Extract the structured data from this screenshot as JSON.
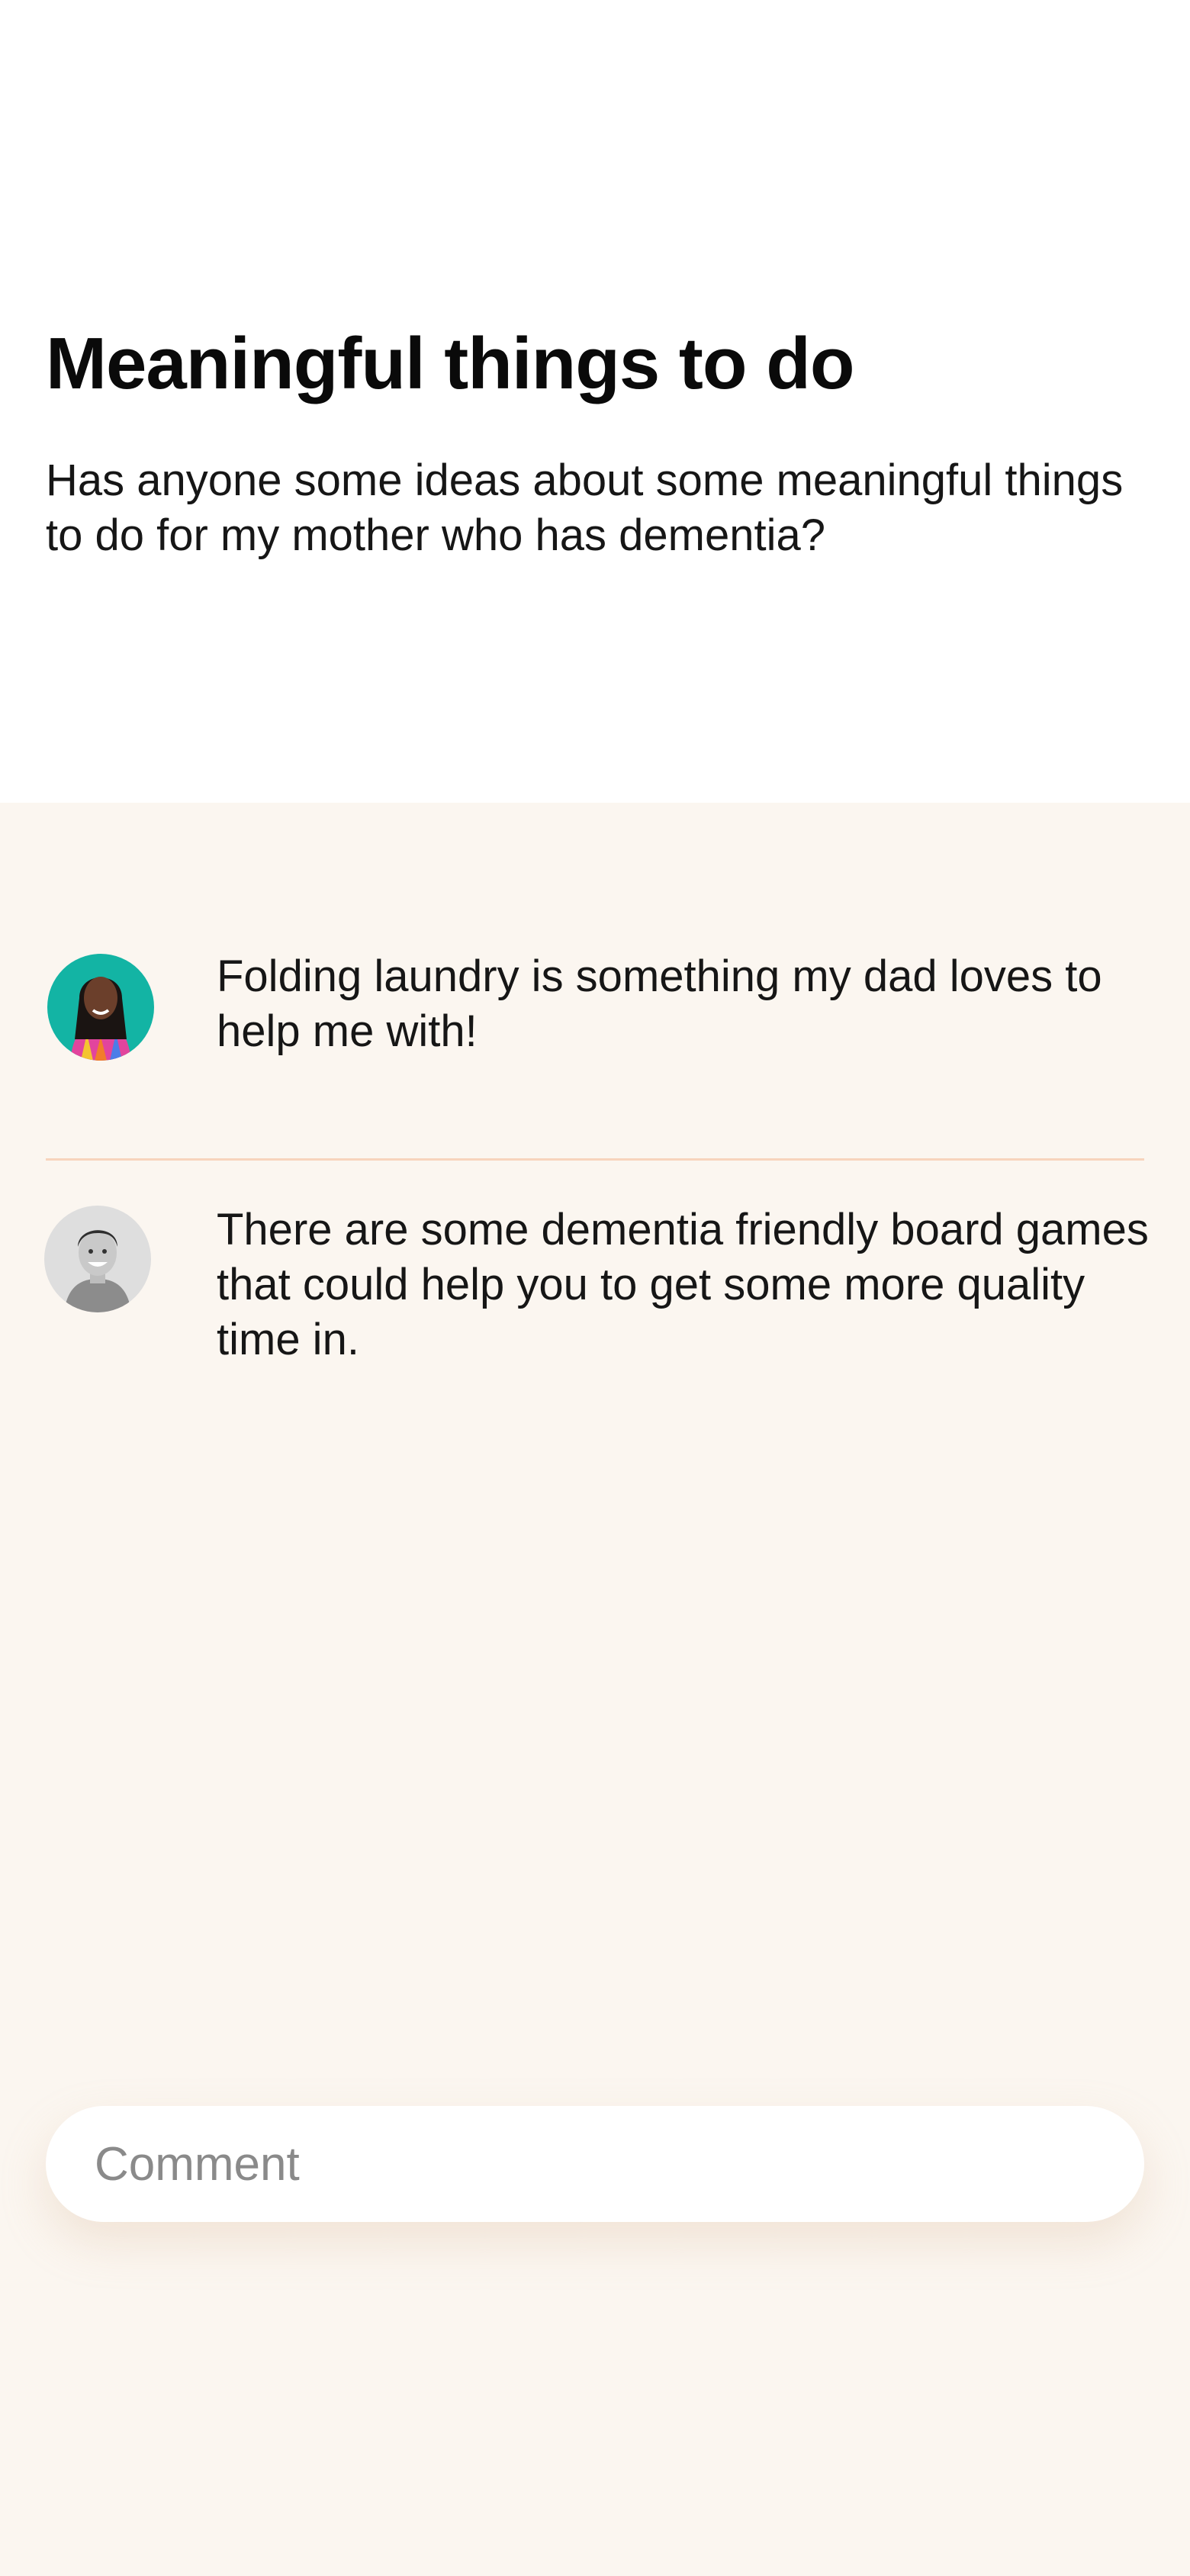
{
  "post": {
    "title": "Meaningful things to do",
    "body": "Has anyone some ideas about some meaningful things to do for my mother who has dementia?"
  },
  "comments": [
    {
      "text": "Folding laundry is something my dad loves to help me with!",
      "avatar_icon": "woman-portrait-avatar"
    },
    {
      "text": "There are some dementia friendly board games that could help you to get some more quality time in.",
      "avatar_icon": "man-portrait-avatar"
    }
  ],
  "comment_input": {
    "placeholder": "Comment",
    "value": ""
  },
  "colors": {
    "page_background": "#fbf6f0",
    "post_background": "#ffffff",
    "divider": "#f7d4bd",
    "avatar_one_background": "#13b4a4",
    "text": "#161616",
    "placeholder": "#8a8a8a"
  }
}
